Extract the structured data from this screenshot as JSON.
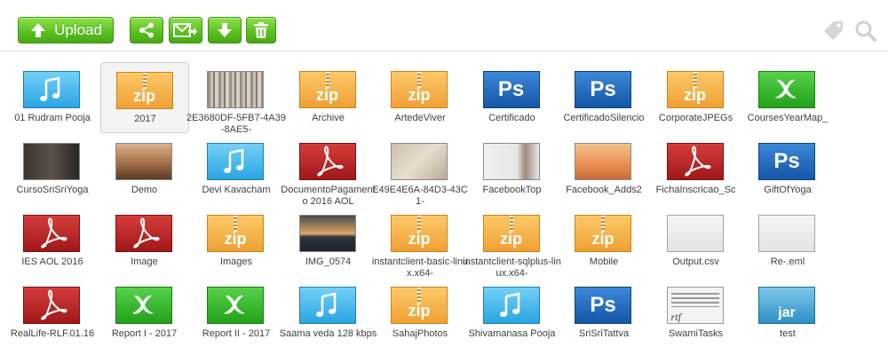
{
  "toolbar": {
    "upload_label": "Upload",
    "accent_color": "#5cc222"
  },
  "files": [
    {
      "name": "01 Rudram Pooja",
      "type": "audio"
    },
    {
      "name": "2017",
      "type": "zip",
      "selected": true
    },
    {
      "name": "2E3680DF-5FB7-4A39-8AE5-",
      "type": "photo-wood"
    },
    {
      "name": "Archive",
      "type": "zip"
    },
    {
      "name": "ArtedeViver",
      "type": "zip"
    },
    {
      "name": "Certificado",
      "type": "ps"
    },
    {
      "name": "CertificadoSilencio",
      "type": "ps"
    },
    {
      "name": "CorporateJPEGs",
      "type": "zip"
    },
    {
      "name": "CoursesYearMap_",
      "type": "xls"
    },
    {
      "name": "CursoSriSriYoga",
      "type": "photo-dark"
    },
    {
      "name": "Demo",
      "type": "photo-room"
    },
    {
      "name": "Devi Kavacham",
      "type": "audio"
    },
    {
      "name": "DocumentoPagamento 2016 AOL",
      "type": "pdf"
    },
    {
      "name": "E49E4E6A-84D3-43C1-",
      "type": "photo-paper"
    },
    {
      "name": "FacebookTop",
      "type": "photo-face"
    },
    {
      "name": "Facebook_Adds2",
      "type": "photo-mindful"
    },
    {
      "name": "FichaInscricao_Sc",
      "type": "pdf"
    },
    {
      "name": "GiftOfYoga",
      "type": "ps"
    },
    {
      "name": "IES AOL 2016",
      "type": "pdf"
    },
    {
      "name": "Image",
      "type": "pdf"
    },
    {
      "name": "Images",
      "type": "zip"
    },
    {
      "name": "IMG_0574",
      "type": "photo-sea"
    },
    {
      "name": "instantclient-basic-linux.x64-",
      "type": "zip"
    },
    {
      "name": "instantclient-sqlplus-linux.x64-",
      "type": "zip"
    },
    {
      "name": "Mobile",
      "type": "zip"
    },
    {
      "name": "Output.csv",
      "type": "blank"
    },
    {
      "name": "Re-.eml",
      "type": "blank"
    },
    {
      "name": "RealLife-RLF.01.16",
      "type": "pdf"
    },
    {
      "name": "Report I - 2017",
      "type": "xls"
    },
    {
      "name": "Report II - 2017",
      "type": "xls"
    },
    {
      "name": "Saama veda 128 kbps",
      "type": "audio"
    },
    {
      "name": "SahajPhotos",
      "type": "zip"
    },
    {
      "name": "Shivamanasa Pooja",
      "type": "audio"
    },
    {
      "name": "SriSriTattva",
      "type": "ps"
    },
    {
      "name": "SwamiTasks",
      "type": "rtf"
    },
    {
      "name": "test",
      "type": "jar"
    }
  ],
  "labels": {
    "zip": "zip",
    "ps": "Ps",
    "jar": "jar",
    "rtf": "rtf"
  },
  "icons": [
    "upload-arrow-icon",
    "share-icon",
    "mail-forward-icon",
    "download-icon",
    "trash-icon",
    "tag-icon",
    "search-icon"
  ]
}
